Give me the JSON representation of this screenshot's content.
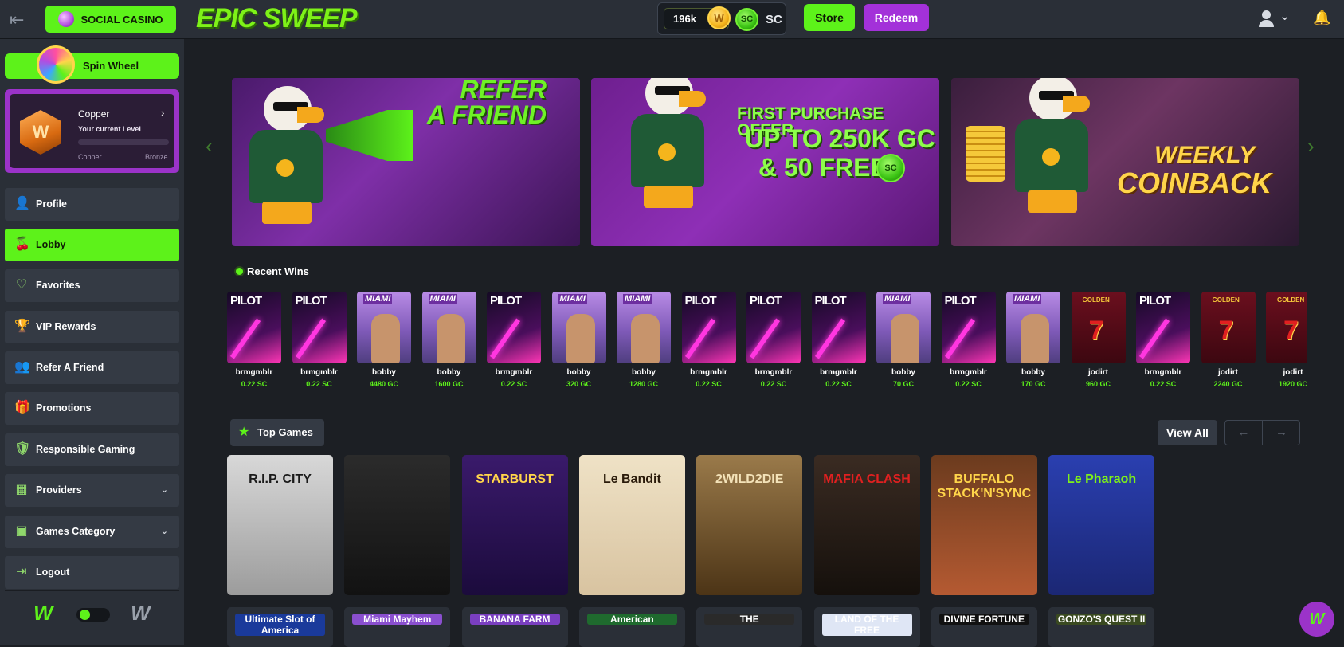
{
  "header": {
    "social_casino": "SOCIAL CASINO",
    "logo": "EPIC SWEEP",
    "balance": "196k",
    "gc_coin": "W",
    "sc_coin": "SC",
    "sc_label": "SC",
    "store": "Store",
    "redeem": "Redeem"
  },
  "sidebar": {
    "spin_wheel": "Spin Wheel",
    "level": {
      "title": "Copper",
      "subtitle": "Your current Level",
      "from": "Copper",
      "to": "Bronze",
      "progress": 0,
      "badge": "W"
    },
    "items": [
      {
        "label": "Profile",
        "icon": "user-icon"
      },
      {
        "label": "Lobby",
        "icon": "cherries-icon"
      },
      {
        "label": "Favorites",
        "icon": "heart-icon"
      },
      {
        "label": "VIP Rewards",
        "icon": "trophy-icon"
      },
      {
        "label": "Refer A Friend",
        "icon": "users-icon"
      },
      {
        "label": "Promotions",
        "icon": "gift-icon"
      },
      {
        "label": "Responsible Gaming",
        "icon": "shield-icon"
      },
      {
        "label": "Providers",
        "icon": "layers-icon"
      },
      {
        "label": "Games Category",
        "icon": "category-icon"
      },
      {
        "label": "Logout",
        "icon": "logout-icon"
      }
    ],
    "theme_mark": "W"
  },
  "banners": {
    "refer": "REFER\nA FRIEND",
    "offer_line1": "FIRST PURCHASE OFFER",
    "offer_line2": "UP TO 250K GC",
    "offer_line3": "& 50 FREE",
    "offer_coin": "SC",
    "coinback_line1": "WEEKLY",
    "coinback_line2": "COINBACK"
  },
  "recent_wins": {
    "title": "Recent Wins",
    "items": [
      {
        "game": "pilot",
        "game_label": "PILOT",
        "user": "brmgmblr",
        "amount": "0.22 SC"
      },
      {
        "game": "pilot",
        "game_label": "PILOT",
        "user": "brmgmblr",
        "amount": "0.22 SC"
      },
      {
        "game": "miami",
        "game_label": "MIAMI",
        "user": "bobby",
        "amount": "4480 GC"
      },
      {
        "game": "miami",
        "game_label": "MIAMI",
        "user": "bobby",
        "amount": "1600 GC"
      },
      {
        "game": "pilot",
        "game_label": "PILOT",
        "user": "brmgmblr",
        "amount": "0.22 SC"
      },
      {
        "game": "miami",
        "game_label": "MIAMI",
        "user": "bobby",
        "amount": "320 GC"
      },
      {
        "game": "miami",
        "game_label": "MIAMI",
        "user": "bobby",
        "amount": "1280 GC"
      },
      {
        "game": "pilot",
        "game_label": "PILOT",
        "user": "brmgmblr",
        "amount": "0.22 SC"
      },
      {
        "game": "pilot",
        "game_label": "PILOT",
        "user": "brmgmblr",
        "amount": "0.22 SC"
      },
      {
        "game": "pilot",
        "game_label": "PILOT",
        "user": "brmgmblr",
        "amount": "0.22 SC"
      },
      {
        "game": "miami",
        "game_label": "MIAMI",
        "user": "bobby",
        "amount": "70 GC"
      },
      {
        "game": "pilot",
        "game_label": "PILOT",
        "user": "brmgmblr",
        "amount": "0.22 SC"
      },
      {
        "game": "miami",
        "game_label": "MIAMI",
        "user": "bobby",
        "amount": "170 GC"
      },
      {
        "game": "golden",
        "game_label": "GOLDEN",
        "user": "jodirt",
        "amount": "960 GC"
      },
      {
        "game": "pilot",
        "game_label": "PILOT",
        "user": "brmgmblr",
        "amount": "0.22 SC"
      },
      {
        "game": "golden",
        "game_label": "GOLDEN",
        "user": "jodirt",
        "amount": "2240 GC"
      },
      {
        "game": "golden",
        "game_label": "GOLDEN",
        "user": "jodirt",
        "amount": "1920 GC"
      }
    ]
  },
  "top_games": {
    "title": "Top Games",
    "view_all": "View All",
    "prev": "←",
    "next": "→",
    "games": [
      {
        "title": "R.I.P. CITY",
        "cls": "g-rip",
        "color": "#1a1a1a"
      },
      {
        "title": "",
        "cls": "g-reaper",
        "color": "#7ef218"
      },
      {
        "title": "STARBURST",
        "cls": "g-star",
        "color": "#ffd54a"
      },
      {
        "title": "Le Bandit",
        "cls": "g-bandit",
        "color": "#2a1a0a"
      },
      {
        "title": "2WILD2DIE",
        "cls": "g-wild",
        "color": "#f3e2b8"
      },
      {
        "title": "MAFIA CLASH",
        "cls": "g-mafia",
        "color": "#e02020"
      },
      {
        "title": "BUFFALO STACK'N'SYNC",
        "cls": "g-buffalo",
        "color": "#ffd54a"
      },
      {
        "title": "Le Pharaoh",
        "cls": "g-pharaoh",
        "color": "#7ef218"
      }
    ],
    "row2": [
      {
        "title": "Ultimate Slot of America",
        "color": "#1a3a9b"
      },
      {
        "title": "Miami Mayhem",
        "color": "#8a4fcf"
      },
      {
        "title": "BANANA FARM",
        "color": "#7a3fc0"
      },
      {
        "title": "American",
        "color": "#1f6a2e"
      },
      {
        "title": "THE",
        "color": "#2a2a2a"
      },
      {
        "title": "LAND OF THE FREE",
        "color": "#dfe6f5"
      },
      {
        "title": "DIVINE FORTUNE",
        "color": "#111111"
      },
      {
        "title": "GONZO'S QUEST II",
        "color": "#3a4a20"
      }
    ]
  },
  "fab": "W"
}
